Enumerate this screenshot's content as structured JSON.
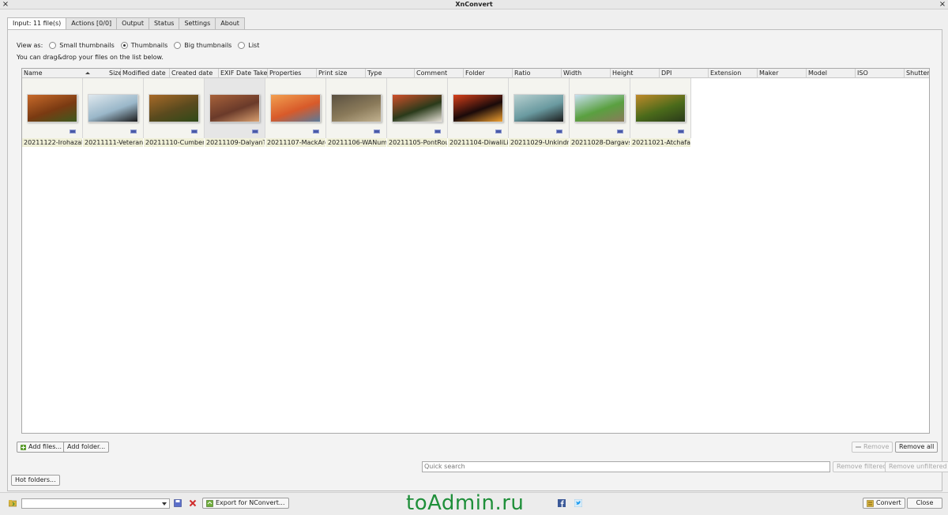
{
  "window": {
    "title": "XnConvert",
    "close_left": "×",
    "close_right": "×"
  },
  "tabs": [
    {
      "label": "Input: 11 file(s)",
      "active": true
    },
    {
      "label": "Actions [0/0]",
      "active": false
    },
    {
      "label": "Output",
      "active": false
    },
    {
      "label": "Status",
      "active": false
    },
    {
      "label": "Settings",
      "active": false
    },
    {
      "label": "About",
      "active": false
    }
  ],
  "view": {
    "label": "View as:",
    "options": [
      "Small thumbnails",
      "Thumbnails",
      "Big thumbnails",
      "List"
    ],
    "selected": "Thumbnails",
    "hint": "You can drag&drop your files on the list below."
  },
  "columns": [
    "Name",
    "Size",
    "Modified date",
    "Created date",
    "EXIF Date Taken",
    "Properties",
    "Print size",
    "Type",
    "Comment",
    "Folder",
    "Ratio",
    "Width",
    "Height",
    "DPI",
    "Extension",
    "Maker",
    "Model",
    "ISO",
    "Shutter"
  ],
  "files": [
    {
      "name": "20211122-Irohazak...",
      "selected": false
    },
    {
      "name": "20211111-Veterans...",
      "selected": false
    },
    {
      "name": "20211110-Cumberl...",
      "selected": false
    },
    {
      "name": "20211109-DalyanT...",
      "selected": true
    },
    {
      "name": "20211107-MackArc...",
      "selected": false
    },
    {
      "name": "20211106-WANum...",
      "selected": false
    },
    {
      "name": "20211105-PontRou...",
      "selected": false
    },
    {
      "name": "20211104-DiwaliLi...",
      "selected": false
    },
    {
      "name": "20211029-Unkindn...",
      "selected": false
    },
    {
      "name": "20211028-Dargavs...",
      "selected": false
    },
    {
      "name": "20211021-Atchafal...",
      "selected": false
    }
  ],
  "buttons": {
    "add_files": "Add files...",
    "add_folder": "Add folder...",
    "remove": "Remove",
    "remove_all": "Remove all",
    "remove_filtered": "Remove filtered",
    "remove_unfiltered": "Remove unfiltered",
    "hot_folders": "Hot folders...",
    "export": "Export for NConvert...",
    "convert": "Convert",
    "close": "Close"
  },
  "search": {
    "placeholder": "Quick search"
  },
  "watermark": "toAdmin.ru",
  "colors": {
    "selected_filename_bg": "#f0f0d8",
    "badge": "#4a5aa8"
  }
}
